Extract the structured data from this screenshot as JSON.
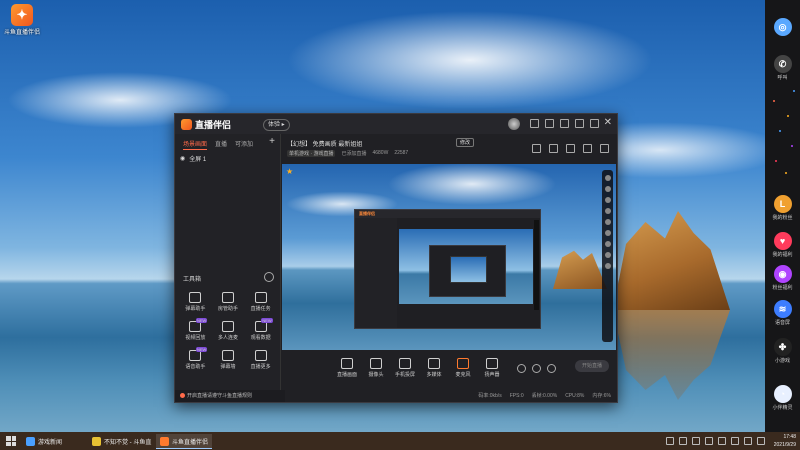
{
  "desktop": {
    "icon_label": "斗鱼直播伴侣"
  },
  "app": {
    "logo_text": "直播伴侣",
    "version_btn": "体验 ▸",
    "left_tabs": [
      "场景画面",
      "直播",
      "可添加"
    ],
    "tab_add": "+",
    "scene_label": "全屏 1",
    "toolbox_title": "工具箱",
    "tools": [
      {
        "label": "弹幕助手",
        "new": ""
      },
      {
        "label": "房管助手",
        "new": ""
      },
      {
        "label": "直播任务",
        "new": ""
      },
      {
        "label": "视频回放",
        "new": "NEW"
      },
      {
        "label": "多人连麦",
        "new": ""
      },
      {
        "label": "观看数据",
        "new": "NEW"
      },
      {
        "label": "语音助手",
        "new": "NEW"
      },
      {
        "label": "弹幕墙",
        "new": ""
      },
      {
        "label": "直播更多",
        "new": ""
      }
    ],
    "notice_text": "开启直播请遵守斗鱼直播规则",
    "room_title": "【幻想】 免费画质 最新姐姐",
    "room_edit": "修改",
    "room_meta": {
      "category": "单机游戏 · 游戏直播",
      "status": "已添加直播",
      "fans": "4680W",
      "views": "22587"
    },
    "bottom_tools": [
      "直播画面",
      "摄像头",
      "手机投屏",
      "多媒体",
      "麦克风",
      "扬声器"
    ],
    "live_btn": "开始直播",
    "status_left": "",
    "status_right": [
      "码率:0kb/s",
      "FPS:0",
      "丢帧:0.00%",
      "CPU:8%",
      "内存:6%"
    ]
  },
  "dock": {
    "items": [
      {
        "label": "",
        "color": "#5aa8ff",
        "glyph": "◎"
      },
      {
        "label": "呼叫",
        "color": "#444",
        "glyph": "✆"
      },
      {
        "label": "我的粉丝",
        "color": "#f0a030",
        "glyph": "L"
      },
      {
        "label": "我的福利",
        "color": "#ff3b5c",
        "glyph": "♥"
      },
      {
        "label": "粉丝福利",
        "color": "#b044ff",
        "glyph": "◉"
      },
      {
        "label": "语音屏",
        "color": "#3d7dff",
        "glyph": "≋"
      },
      {
        "label": "小游戏",
        "color": "#222",
        "glyph": "✤"
      },
      {
        "label": "小伴精灵",
        "color": "#e8f0ff",
        "glyph": "◔"
      }
    ]
  },
  "taskbar": {
    "apps": [
      {
        "label": "游戏新闻",
        "color": "#4aa0ff"
      },
      {
        "label": "不知不觉 - 斗鱼直",
        "color": "#e8c233"
      },
      {
        "label": "斗鱼直播伴侣",
        "color": "#ff7a2e"
      }
    ],
    "time": "17:48",
    "date": "2021/9/29"
  }
}
